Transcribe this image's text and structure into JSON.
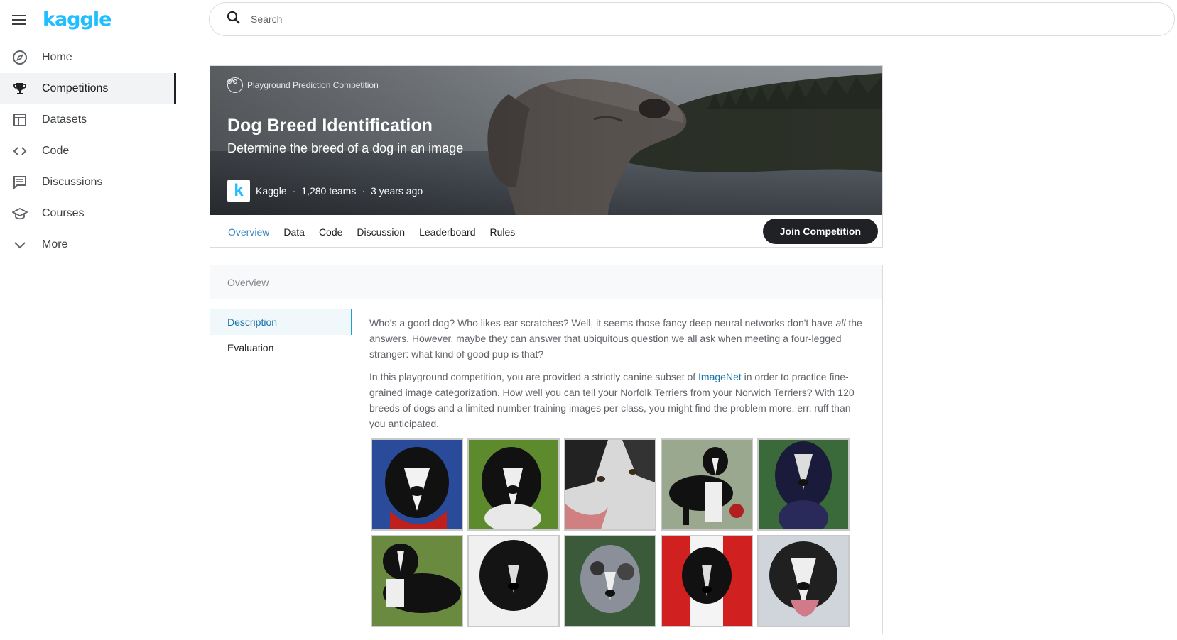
{
  "brand": {
    "logo": "kaggle",
    "menu_icon": "hamburger-menu-icon"
  },
  "nav": {
    "items": [
      {
        "label": "Home",
        "icon": "compass-icon",
        "active": false
      },
      {
        "label": "Competitions",
        "icon": "trophy-icon",
        "active": true
      },
      {
        "label": "Datasets",
        "icon": "table-icon",
        "active": false
      },
      {
        "label": "Code",
        "icon": "code-icon",
        "active": false
      },
      {
        "label": "Discussions",
        "icon": "comments-icon",
        "active": false
      },
      {
        "label": "Courses",
        "icon": "graduation-cap-icon",
        "active": false
      },
      {
        "label": "More",
        "icon": "chevron-down-icon",
        "active": false
      }
    ]
  },
  "search": {
    "placeholder": "Search",
    "value": ""
  },
  "competition": {
    "category": "Playground Prediction Competition",
    "title": "Dog Breed Identification",
    "subtitle": "Determine the breed of a dog in an image",
    "host": "Kaggle",
    "teams": "1,280 teams",
    "age": "3 years ago",
    "host_logo_letter": "k",
    "separator": "·"
  },
  "tabs": [
    {
      "label": "Overview",
      "active": true
    },
    {
      "label": "Data",
      "active": false
    },
    {
      "label": "Code",
      "active": false
    },
    {
      "label": "Discussion",
      "active": false
    },
    {
      "label": "Leaderboard",
      "active": false
    },
    {
      "label": "Rules",
      "active": false
    }
  ],
  "join_button": "Join Competition",
  "overview": {
    "header": "Overview",
    "subnav": [
      {
        "label": "Description",
        "active": true
      },
      {
        "label": "Evaluation",
        "active": false
      }
    ],
    "p1_a": "Who's a good dog? Who likes ear scratches? Well, it seems those fancy deep neural networks don't have ",
    "p1_em": "all",
    "p1_b": " the answers. However, maybe they can answer that ubiquitous question we all ask when meeting a four-legged stranger: what kind of good pup is that?",
    "p2_a": "In this playground competition, you are provided a strictly canine subset of ",
    "p2_link": "ImageNet",
    "p2_b": " in order to practice fine-grained image categorization. How well you can tell your Norfolk Terriers from your Norwich Terriers? With 120 breeds of dogs and a limited number training images per class, you might find the problem more, err, ruff than you anticipated."
  },
  "colors": {
    "accent": "#20beff",
    "link": "#1a73a8",
    "active_tab": "#3a87c4",
    "button": "#202124"
  }
}
